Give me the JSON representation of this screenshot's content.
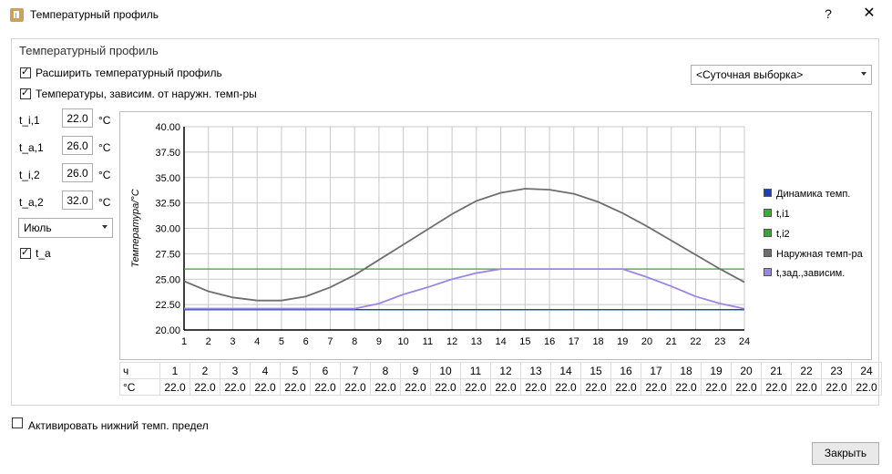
{
  "window": {
    "title": "Температурный профиль",
    "help": "?",
    "close": "✕"
  },
  "group": {
    "title": "Температурный профиль"
  },
  "options": {
    "extend_profile": {
      "label": "Расширить температурный профиль",
      "checked": true
    },
    "outdoor_dependent": {
      "label": "Температуры, зависим. от наружн. темп-ры",
      "checked": true
    },
    "sample_select": "<Суточная выборка>",
    "lower_limit": {
      "label": "Активировать нижний темп. предел",
      "checked": false
    }
  },
  "params": [
    {
      "label": "t_i,1",
      "value": "22.0",
      "unit": "°C"
    },
    {
      "label": "t_a,1",
      "value": "26.0",
      "unit": "°C"
    },
    {
      "label": "t_i,2",
      "value": "26.0",
      "unit": "°C"
    },
    {
      "label": "t_a,2",
      "value": "32.0",
      "unit": "°C"
    }
  ],
  "month_select": "Июль",
  "ta_checkbox": {
    "label": "t_a",
    "checked": true
  },
  "chart_data": {
    "type": "line",
    "ylabel": "Температура/°C",
    "xlabel": "",
    "x": [
      1,
      2,
      3,
      4,
      5,
      6,
      7,
      8,
      9,
      10,
      11,
      12,
      13,
      14,
      15,
      16,
      17,
      18,
      19,
      20,
      21,
      22,
      23,
      24
    ],
    "xlim": [
      1,
      24
    ],
    "ylim": [
      20,
      40
    ],
    "yticks": [
      "20.00",
      "22.50",
      "25.00",
      "27.50",
      "30.00",
      "32.50",
      "35.00",
      "37.50",
      "40.00"
    ],
    "grid": true,
    "legend_position": "right",
    "series": [
      {
        "name": "Динамика темп.",
        "color": "#1f3fbf",
        "values": [
          22,
          22,
          22,
          22,
          22,
          22,
          22,
          22,
          22,
          22,
          22,
          22,
          22,
          22,
          22,
          22,
          22,
          22,
          22,
          22,
          22,
          22,
          22,
          22
        ]
      },
      {
        "name": "t,i1",
        "color": "#33b233",
        "values": [
          22,
          22,
          22,
          22,
          22,
          22,
          22,
          22,
          22,
          22,
          22,
          22,
          22,
          22,
          22,
          22,
          22,
          22,
          22,
          22,
          22,
          22,
          22,
          22
        ]
      },
      {
        "name": "t,i2",
        "color": "#3aa33a",
        "values": [
          26,
          26,
          26,
          26,
          26,
          26,
          26,
          26,
          26,
          26,
          26,
          26,
          26,
          26,
          26,
          26,
          26,
          26,
          26,
          26,
          26,
          26,
          26,
          26
        ]
      },
      {
        "name": "Наружная темп-ра",
        "color": "#6e6e6e",
        "values": [
          24.8,
          23.8,
          23.2,
          22.9,
          22.9,
          23.3,
          24.2,
          25.4,
          26.9,
          28.4,
          29.9,
          31.4,
          32.7,
          33.5,
          33.9,
          33.8,
          33.4,
          32.6,
          31.5,
          30.2,
          28.8,
          27.4,
          26.0,
          24.7
        ]
      },
      {
        "name": "t,зад.,зависим.",
        "color": "#9a86e6",
        "values": [
          22.1,
          22.1,
          22.1,
          22.1,
          22.1,
          22.1,
          22.1,
          22.1,
          22.6,
          23.5,
          24.2,
          25.0,
          25.6,
          26.0,
          26.0,
          26.0,
          26.0,
          26.0,
          26.0,
          25.2,
          24.3,
          23.3,
          22.6,
          22.1
        ]
      }
    ]
  },
  "table": {
    "row1_header": "ч",
    "row2_header": "°C",
    "hours": [
      "1",
      "2",
      "3",
      "4",
      "5",
      "6",
      "7",
      "8",
      "9",
      "10",
      "11",
      "12",
      "13",
      "14",
      "15",
      "16",
      "17",
      "18",
      "19",
      "20",
      "21",
      "22",
      "23",
      "24"
    ],
    "values": [
      "22.0",
      "22.0",
      "22.0",
      "22.0",
      "22.0",
      "22.0",
      "22.0",
      "22.0",
      "22.0",
      "22.0",
      "22.0",
      "22.0",
      "22.0",
      "22.0",
      "22.0",
      "22.0",
      "22.0",
      "22.0",
      "22.0",
      "22.0",
      "22.0",
      "22.0",
      "22.0",
      "22.0"
    ]
  },
  "buttons": {
    "close": "Закрыть"
  }
}
